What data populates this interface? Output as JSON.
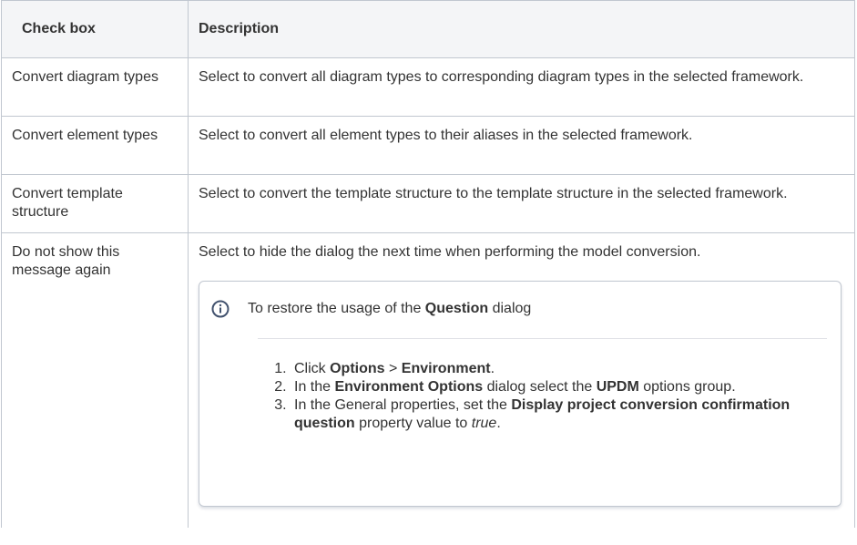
{
  "table": {
    "headers": {
      "checkbox": "Check box",
      "description": "Description"
    },
    "rows": [
      {
        "checkbox": "Convert diagram types",
        "description": "Select to convert all diagram types to corresponding diagram types in the selected framework."
      },
      {
        "checkbox": "Convert element types",
        "description": "Select to convert all element types to their aliases in the selected framework."
      },
      {
        "checkbox": "Convert template structure",
        "description": "Select to convert the template structure to the template structure in the selected framework."
      },
      {
        "checkbox": "Do not show this message again",
        "description": "Select to hide the dialog the next time when performing the model conversion."
      }
    ]
  },
  "info_panel": {
    "icon": "info-icon",
    "title_prefix": "To restore the usage of the ",
    "title_bold": "Question",
    "title_suffix": " dialog",
    "steps": [
      {
        "t1": "Click ",
        "b1": "Options",
        "t2": " > ",
        "b2": "Environment",
        "t3": "."
      },
      {
        "t1": "In the ",
        "b1": "Environment Options",
        "t2": " dialog select the ",
        "b2": "UPDM",
        "t3": " options group."
      },
      {
        "t1": "In the General properties, set the ",
        "b1": "Display project conversion confirmation question",
        "t2": " property value to ",
        "i1": "true",
        "t3": "."
      }
    ],
    "colors": {
      "border": "#c1c7d0",
      "icon": "#42526e",
      "header_bg": "#f4f5f7"
    }
  }
}
